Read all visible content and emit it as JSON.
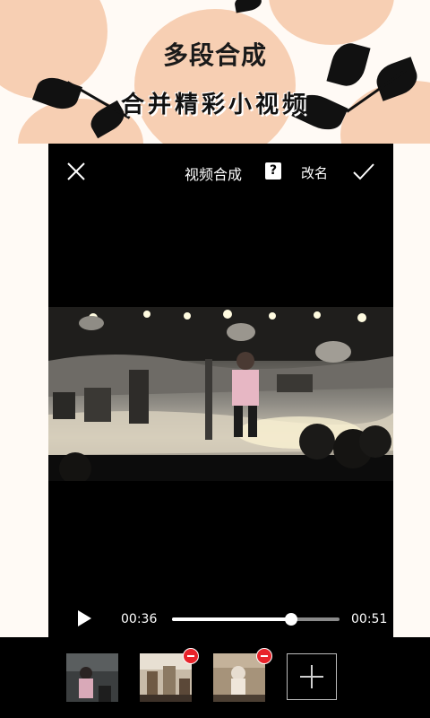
{
  "banner": {
    "title": "多段合成",
    "subtitle": "合并精彩小视频"
  },
  "header": {
    "title": "视频合成",
    "help_label": "?",
    "rename_label": "改名"
  },
  "player": {
    "current_time": "00:36",
    "total_time": "00:51",
    "progress": 0.71
  },
  "clips": [
    {
      "name": "clip-1",
      "removable": false
    },
    {
      "name": "clip-2",
      "removable": true
    },
    {
      "name": "clip-3",
      "removable": true
    }
  ],
  "colors": {
    "banner_bg": "#fffaf5",
    "peach": "#f7cfb3",
    "remove_red": "#e8232a",
    "app_bg": "#000000"
  }
}
